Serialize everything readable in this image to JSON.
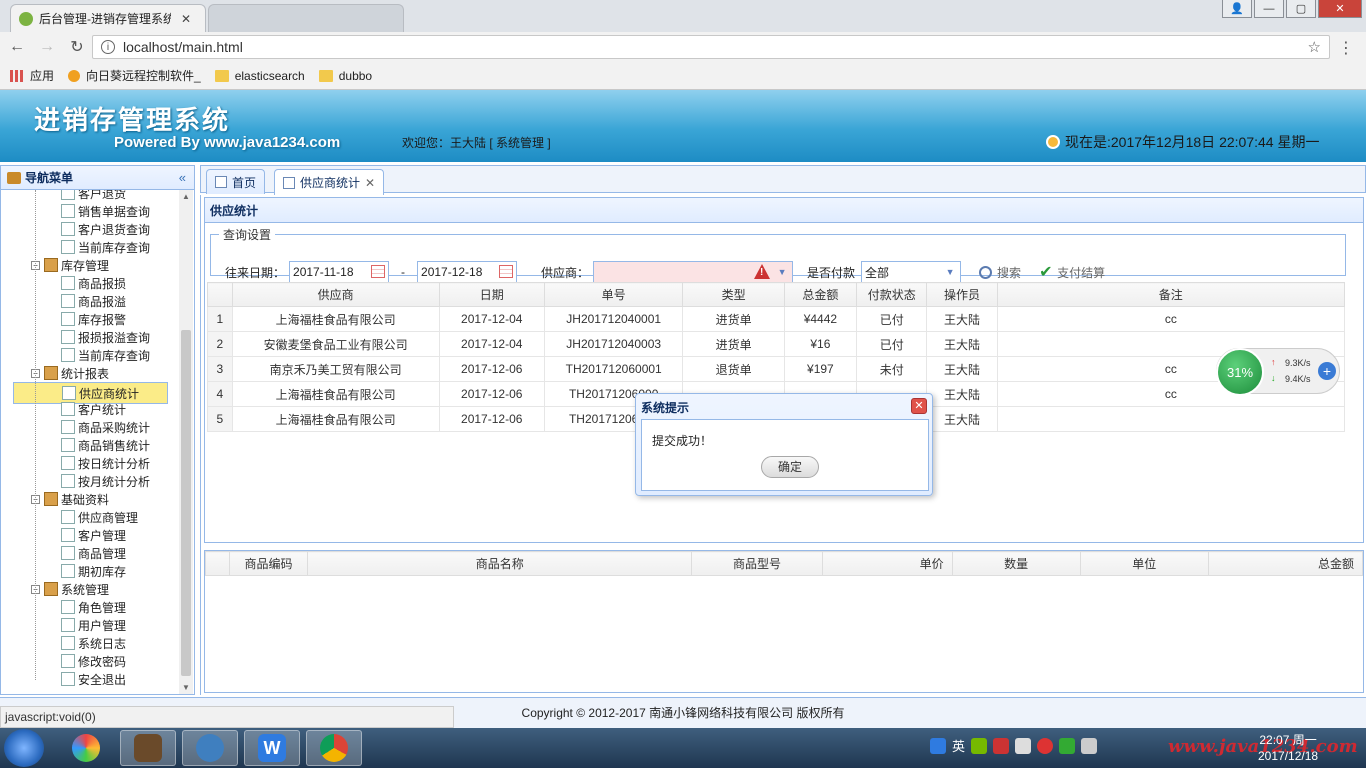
{
  "browser": {
    "tabs": [
      {
        "title": "后台管理-进销存管理系统"
      },
      {
        "title": ""
      }
    ],
    "url": "localhost/main.html",
    "bookmarks": [
      "应用",
      "向日葵远程控制软件_",
      "elasticsearch",
      "dubbo"
    ]
  },
  "header": {
    "system_name": "进销存管理系统",
    "powered_by": "Powered By www.java1234.com",
    "welcome": "欢迎您：王大陆 [ 系统管理 ]",
    "clock": "现在是:2017年12月18日 22:07:44 星期一"
  },
  "nav": {
    "title": "导航菜单",
    "items": [
      {
        "label": "客户退货",
        "level": 2
      },
      {
        "label": "销售单据查询",
        "level": 2
      },
      {
        "label": "客户退货查询",
        "level": 2
      },
      {
        "label": "当前库存查询",
        "level": 2
      },
      {
        "label": "库存管理",
        "level": 1
      },
      {
        "label": "商品报损",
        "level": 2
      },
      {
        "label": "商品报溢",
        "level": 2
      },
      {
        "label": "库存报警",
        "level": 2
      },
      {
        "label": "报损报溢查询",
        "level": 2
      },
      {
        "label": "当前库存查询",
        "level": 2
      },
      {
        "label": "统计报表",
        "level": 1
      },
      {
        "label": "供应商统计",
        "level": 2,
        "selected": true
      },
      {
        "label": "客户统计",
        "level": 2
      },
      {
        "label": "商品采购统计",
        "level": 2
      },
      {
        "label": "商品销售统计",
        "level": 2
      },
      {
        "label": "按日统计分析",
        "level": 2
      },
      {
        "label": "按月统计分析",
        "level": 2
      },
      {
        "label": "基础资料",
        "level": 1
      },
      {
        "label": "供应商管理",
        "level": 2
      },
      {
        "label": "客户管理",
        "level": 2
      },
      {
        "label": "商品管理",
        "level": 2
      },
      {
        "label": "期初库存",
        "level": 2
      },
      {
        "label": "系统管理",
        "level": 1
      },
      {
        "label": "角色管理",
        "level": 2
      },
      {
        "label": "用户管理",
        "level": 2
      },
      {
        "label": "系统日志",
        "level": 2
      },
      {
        "label": "修改密码",
        "level": 2
      },
      {
        "label": "安全退出",
        "level": 2
      }
    ]
  },
  "tabs": [
    {
      "label": "首页"
    },
    {
      "label": "供应商统计"
    }
  ],
  "panel": {
    "title": "供应统计",
    "query_legend": "查询设置",
    "date_label": "往来日期：",
    "date_from": "2017-11-18",
    "dash": "-",
    "date_to": "2017-12-18",
    "supplier_label": "供应商：",
    "supplier_value": "",
    "paid_label": "是否付款",
    "paid_value": "全部",
    "search_btn": "搜索",
    "pay_btn": "支付结算"
  },
  "grid1": {
    "columns": [
      "供应商",
      "日期",
      "单号",
      "类型",
      "总金额",
      "付款状态",
      "操作员",
      "备注"
    ],
    "rows": [
      [
        "1",
        "上海福桂食品有限公司",
        "2017-12-04",
        "JH201712040001",
        "进货单",
        "¥4442",
        "已付",
        "王大陆",
        "cc"
      ],
      [
        "2",
        "安徽麦堡食品工业有限公司",
        "2017-12-04",
        "JH201712040003",
        "进货单",
        "¥16",
        "已付",
        "王大陆",
        ""
      ],
      [
        "3",
        "南京禾乃美工贸有限公司",
        "2017-12-06",
        "TH201712060001",
        "退货单",
        "¥197",
        "未付",
        "王大陆",
        "cc"
      ],
      [
        "4",
        "上海福桂食品有限公司",
        "2017-12-06",
        "TH20171206000",
        "",
        "",
        "",
        "王大陆",
        "cc"
      ],
      [
        "5",
        "上海福桂食品有限公司",
        "2017-12-06",
        "TH20171206000",
        "",
        "",
        "",
        "王大陆",
        ""
      ]
    ]
  },
  "grid2": {
    "columns": [
      "商品编码",
      "商品名称",
      "商品型号",
      "单价",
      "数量",
      "单位",
      "总金额"
    ]
  },
  "dialog": {
    "title": "系统提示",
    "message": "提交成功！",
    "ok": "确定"
  },
  "net_widget": {
    "percent": "31%",
    "up": "9.3K/s",
    "down": "9.4K/s"
  },
  "footer": "Copyright © 2012-2017 南通小锋网络科技有限公司 版权所有",
  "status": "javascript:void(0)",
  "taskbar": {
    "ime": "英",
    "time": "22:07 周一",
    "date": "2017/12/18",
    "watermark": "www.java1234.com"
  }
}
